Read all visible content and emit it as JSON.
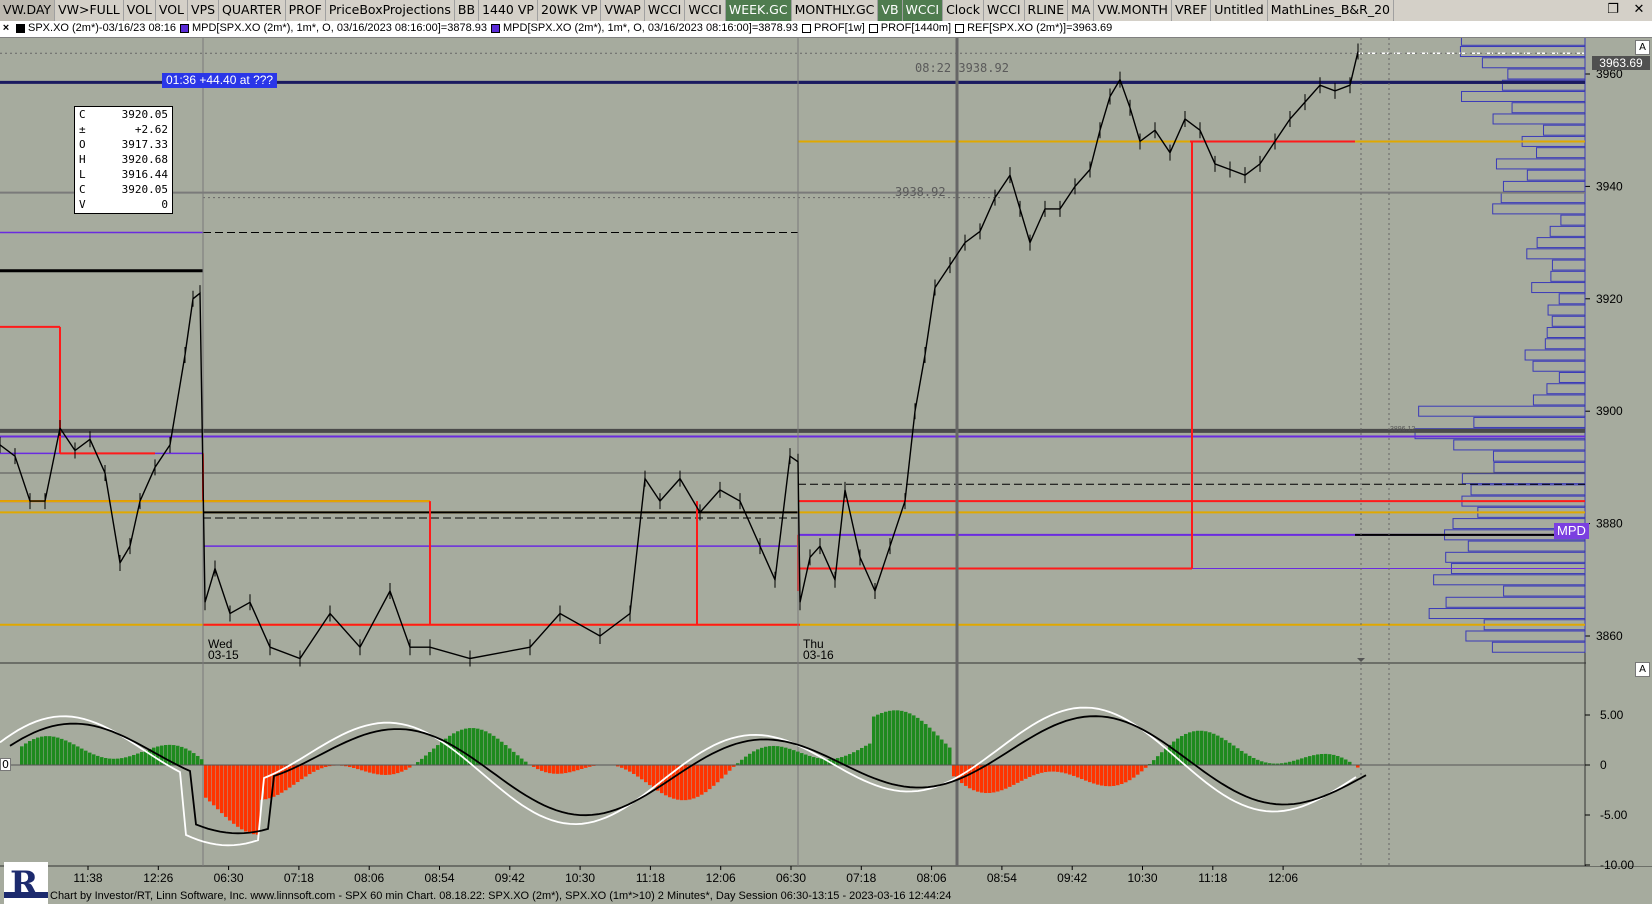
{
  "toolbar": {
    "tabs": [
      {
        "label": "VW.DAY",
        "style": "sel"
      },
      {
        "label": "VW>FULL",
        "style": ""
      },
      {
        "label": "VOL",
        "style": ""
      },
      {
        "label": "VOL",
        "style": ""
      },
      {
        "label": "VPS",
        "style": ""
      },
      {
        "label": "QUARTER",
        "style": ""
      },
      {
        "label": "PROF",
        "style": ""
      },
      {
        "label": "PriceBoxProjections",
        "style": ""
      },
      {
        "label": "BB",
        "style": ""
      },
      {
        "label": "1440 VP",
        "style": ""
      },
      {
        "label": "20WK VP",
        "style": ""
      },
      {
        "label": "VWAP",
        "style": ""
      },
      {
        "label": "WCCI",
        "style": ""
      },
      {
        "label": "WCCI",
        "style": ""
      },
      {
        "label": "WEEK.GC",
        "style": "green"
      },
      {
        "label": "MONTHLY.GC",
        "style": ""
      },
      {
        "label": "VB",
        "style": "green"
      },
      {
        "label": "WCCI",
        "style": "green"
      },
      {
        "label": "Clock",
        "style": ""
      },
      {
        "label": "WCCI",
        "style": ""
      },
      {
        "label": "RLINE",
        "style": ""
      },
      {
        "label": "MA",
        "style": ""
      },
      {
        "label": "VW.MONTH",
        "style": ""
      },
      {
        "label": "VREF",
        "style": ""
      },
      {
        "label": "Untitled",
        "style": ""
      },
      {
        "label": "MathLines_B&R_20",
        "style": ""
      }
    ],
    "window_controls": [
      "restore-icon",
      "close-icon"
    ]
  },
  "legend": {
    "items": [
      {
        "color": "#000000",
        "text": "SPX.XO (2m*)-03/16/23 08:16"
      },
      {
        "color": "#5a2bd6",
        "text": "MPD[SPX.XO (2m*), 1m*, O, 03/16/2023 08:16:00]=3878.93"
      },
      {
        "color": "#5a2bd6",
        "text": "MPD[SPX.XO (2m*), 1m*, O, 03/16/2023 08:16:00]=3878.93"
      },
      {
        "color": "#ffffff",
        "text": "PROF[1w]"
      },
      {
        "color": "#ffffff",
        "text": "PROF[1440m]"
      },
      {
        "color": "#ffffff",
        "text": "REF[SPX.XO (2m*)]=3963.69"
      }
    ]
  },
  "hint_text": "01:36  +44.40 at ???",
  "databox": [
    {
      "k": "C",
      "v": "3920.05"
    },
    {
      "k": "±",
      "v": "+2.62"
    },
    {
      "k": "O",
      "v": "3917.33"
    },
    {
      "k": "H",
      "v": "3920.68"
    },
    {
      "k": "L",
      "v": "3916.44"
    },
    {
      "k": "C",
      "v": "3920.05"
    },
    {
      "k": "V",
      "v": "0"
    }
  ],
  "annotations": {
    "high_label": "08:22  3938.92",
    "level_label": "3938.92",
    "small_level": "3896.12",
    "day1": {
      "name": "Wed",
      "date": "03-15"
    },
    "day2": {
      "name": "Thu",
      "date": "03-16"
    }
  },
  "price_axis": {
    "ticks": [
      "3960",
      "3940",
      "3920",
      "3900",
      "3880",
      "3860"
    ],
    "current": "3963.69",
    "mpd_tag": "MPD"
  },
  "osc_axis": {
    "ticks": [
      "5.00",
      "0",
      "-5.00",
      "-10.00"
    ],
    "zero_box": "0"
  },
  "time_axis": {
    "labels": [
      "11:38",
      "12:26",
      "06:30",
      "07:18",
      "08:06",
      "08:54",
      "09:42",
      "10:30",
      "11:18",
      "12:06",
      "06:30",
      "07:18",
      "08:06",
      "08:54",
      "09:42",
      "10:30",
      "11:18",
      "12:06"
    ]
  },
  "panel_buttons": [
    "A",
    "A"
  ],
  "status_text": "Chart by Investor/RT, Linn Software, Inc. www.linnsoft.com - SPX 60 min Chart.   08.18.22: SPX.XO (2m*), SPX.XO (1m*>10) 2 Minutes*, Day Session 06:30-13:15 - 2023-03-16 12:44:24",
  "colors": {
    "bg": "#a6ab9e",
    "red": "#ff1a1a",
    "gold": "#e0a800",
    "purple": "#6a2be0",
    "navy": "#1a1a60",
    "green": "#1e8a1e",
    "orange": "#ff3300",
    "profile": "#3a3ab8"
  },
  "chart_data": {
    "type": "line",
    "price_range": [
      3856,
      3973
    ],
    "osc_range": [
      -11,
      10
    ],
    "levels": [
      {
        "name": "mpd",
        "value": 3878.93
      },
      {
        "name": "ref",
        "value": 3963.69
      },
      {
        "name": "high",
        "value": 3938.92
      },
      {
        "name": "small",
        "value": 3896.12
      }
    ]
  }
}
